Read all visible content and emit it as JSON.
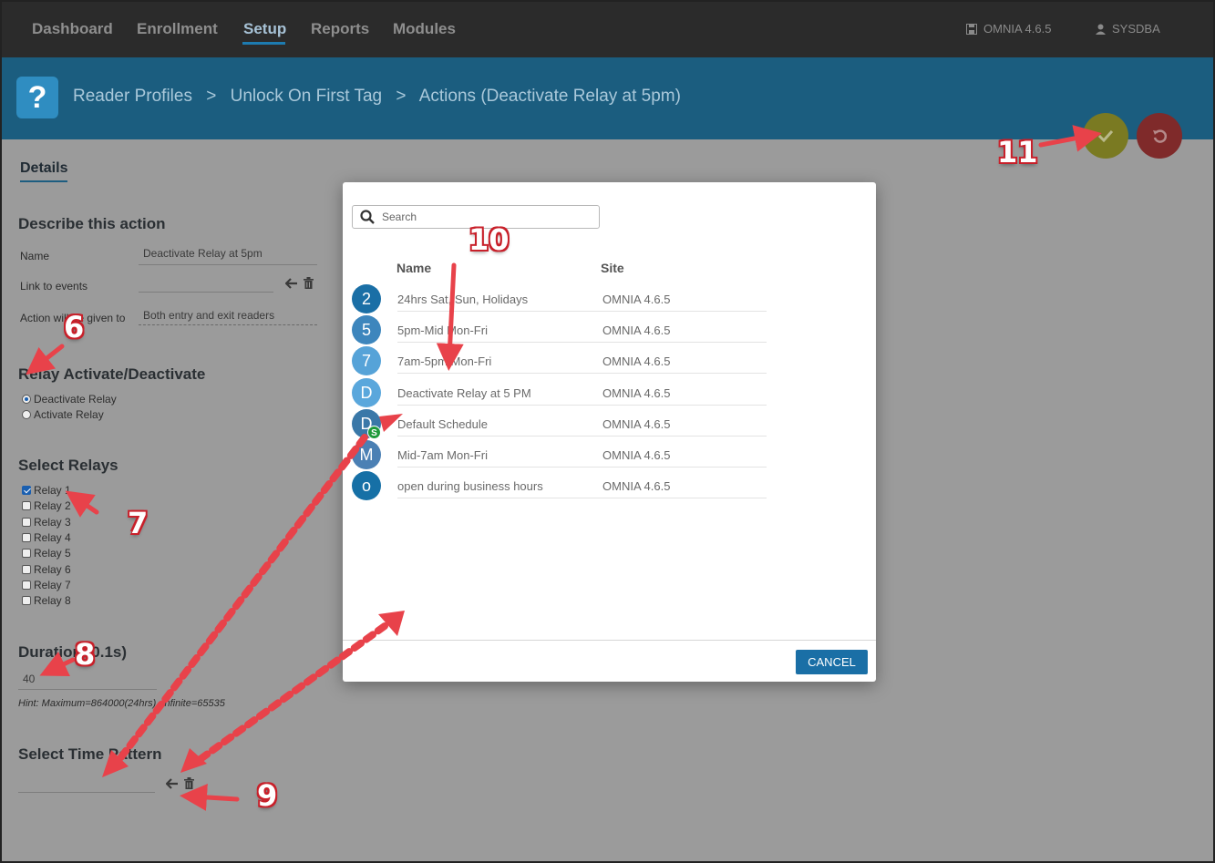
{
  "nav": {
    "items": [
      "Dashboard",
      "Enrollment",
      "Setup",
      "Reports",
      "Modules"
    ],
    "version": "OMNIA 4.6.5",
    "user": "SYSDBA"
  },
  "header": {
    "help_glyph": "?",
    "crumbs": [
      "Reader Profiles",
      ">",
      "Unlock On First Tag",
      ">",
      "Actions (Deactivate Relay at 5pm)"
    ]
  },
  "form": {
    "tab": "Details",
    "describe_title": "Describe this action",
    "name_label": "Name",
    "name_value": "Deactivate Relay at 5pm",
    "link_label": "Link to events",
    "action_label": "Action will be given to",
    "action_value": "Both entry and exit readers",
    "relay_title": "Relay Activate/Deactivate",
    "relay_options": [
      "Deactivate Relay",
      "Activate Relay"
    ],
    "relays_title": "Select Relays",
    "relays": [
      "Relay 1",
      "Relay 2",
      "Relay 3",
      "Relay 4",
      "Relay 5",
      "Relay 6",
      "Relay 7",
      "Relay 8"
    ],
    "duration_title": "Duration (0.1s)",
    "duration_value": "40",
    "hint": "Hint: Maximum=864000(24hrs), Infinite=65535",
    "time_pattern_title": "Select Time Pattern"
  },
  "modal": {
    "search_placeholder": "Search",
    "col_name": "Name",
    "col_site": "Site",
    "rows": [
      {
        "initial": "2",
        "name": "24hrs Sat, Sun, Holidays",
        "site": "OMNIA 4.6.5",
        "color": "#1a6fa6"
      },
      {
        "initial": "5",
        "name": "5pm-Mid Mon-Fri",
        "site": "OMNIA 4.6.5",
        "color": "#3d86bd"
      },
      {
        "initial": "7",
        "name": "7am-5pm Mon-Fri",
        "site": "OMNIA 4.6.5",
        "color": "#56a3d8"
      },
      {
        "initial": "D",
        "name": "Deactivate Relay at 5 PM",
        "site": "OMNIA 4.6.5",
        "color": "#5aa7dc"
      },
      {
        "initial": "D",
        "name": "Default Schedule",
        "site": "OMNIA 4.6.5",
        "color": "#3a78a8",
        "badge": "S"
      },
      {
        "initial": "M",
        "name": "Mid-7am Mon-Fri",
        "site": "OMNIA 4.6.5",
        "color": "#4b80b4"
      },
      {
        "initial": "o",
        "name": "open during business hours",
        "site": "OMNIA 4.6.5",
        "color": "#1670a6"
      }
    ],
    "cancel": "CANCEL"
  },
  "annotations": [
    "6",
    "7",
    "8",
    "9",
    "10",
    "11"
  ],
  "colors": {
    "nav_bg": "#2b2b2b",
    "header_bg": "#1b5d7f",
    "accent": "#1a6fa6",
    "arrow": "#e8424a"
  }
}
